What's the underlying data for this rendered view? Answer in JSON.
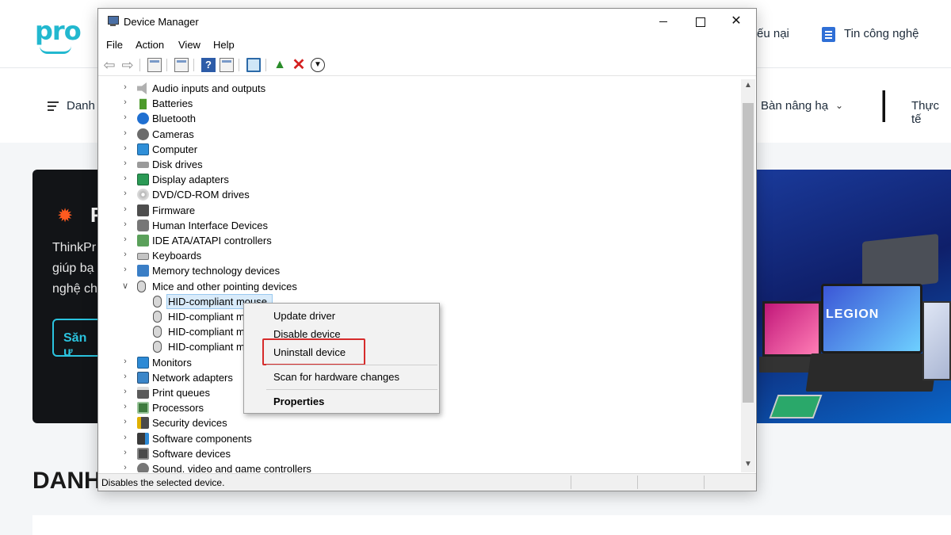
{
  "site": {
    "logo": "pro",
    "top_links": [
      "ếu nại",
      "Tin công nghệ"
    ],
    "nav": {
      "menu_label": "Danh",
      "item_right": "Bàn nâng hạ",
      "item_far": "Thực tế"
    },
    "banner": {
      "title": "F",
      "lines": [
        "ThinkPr",
        "giúp bạ",
        "nghệ ch"
      ],
      "button": "Săn ư",
      "laptop_brand": "LEGION"
    },
    "section_title": "DANH"
  },
  "window": {
    "title": "Device Manager",
    "menu": [
      "File",
      "Action",
      "View",
      "Help"
    ],
    "toolbar_icons": [
      "back-icon",
      "forward-icon",
      "properties-icon",
      "details-icon",
      "help-icon",
      "view-icon",
      "monitor-icon",
      "update-driver-icon",
      "uninstall-icon",
      "download-icon"
    ],
    "tree": [
      {
        "label": "Audio inputs and outputs",
        "icon": "audio-icon",
        "expanded": false
      },
      {
        "label": "Batteries",
        "icon": "battery-icon",
        "expanded": false
      },
      {
        "label": "Bluetooth",
        "icon": "bluetooth-icon",
        "expanded": false
      },
      {
        "label": "Cameras",
        "icon": "camera-icon",
        "expanded": false
      },
      {
        "label": "Computer",
        "icon": "computer-icon",
        "expanded": false
      },
      {
        "label": "Disk drives",
        "icon": "disk-icon",
        "expanded": false
      },
      {
        "label": "Display adapters",
        "icon": "display-icon",
        "expanded": false
      },
      {
        "label": "DVD/CD-ROM drives",
        "icon": "dvd-icon",
        "expanded": false
      },
      {
        "label": "Firmware",
        "icon": "firmware-icon",
        "expanded": false
      },
      {
        "label": "Human Interface Devices",
        "icon": "hid-icon",
        "expanded": false
      },
      {
        "label": "IDE ATA/ATAPI controllers",
        "icon": "ide-icon",
        "expanded": false
      },
      {
        "label": "Keyboards",
        "icon": "keyboard-icon",
        "expanded": false
      },
      {
        "label": "Memory technology devices",
        "icon": "memory-icon",
        "expanded": false
      },
      {
        "label": "Mice and other pointing devices",
        "icon": "mouse-icon",
        "expanded": true
      },
      {
        "label": "HID-compliant mouse",
        "icon": "mouse-icon",
        "child": true,
        "selected": true
      },
      {
        "label": "HID-compliant m",
        "icon": "mouse-icon",
        "child": true
      },
      {
        "label": "HID-compliant m",
        "icon": "mouse-icon",
        "child": true
      },
      {
        "label": "HID-compliant m",
        "icon": "mouse-icon",
        "child": true
      },
      {
        "label": "Monitors",
        "icon": "monitor-icon",
        "expanded": false
      },
      {
        "label": "Network adapters",
        "icon": "network-icon",
        "expanded": false
      },
      {
        "label": "Print queues",
        "icon": "printer-icon",
        "expanded": false
      },
      {
        "label": "Processors",
        "icon": "processor-icon",
        "expanded": false
      },
      {
        "label": "Security devices",
        "icon": "security-icon",
        "expanded": false
      },
      {
        "label": "Software components",
        "icon": "software-components-icon",
        "expanded": false
      },
      {
        "label": "Software devices",
        "icon": "software-devices-icon",
        "expanded": false
      },
      {
        "label": "Sound, video and game controllers",
        "icon": "sound-icon",
        "expanded": false
      }
    ],
    "context_menu": {
      "update_driver": "Update driver",
      "disable_device": "Disable device",
      "uninstall_device": "Uninstall device",
      "scan": "Scan for hardware changes",
      "properties": "Properties"
    },
    "status_text": "Disables the selected device."
  },
  "colors": {
    "highlight_border": "#d62b2b",
    "selection": "#d9ebfa",
    "accent": "#22b8cf"
  }
}
